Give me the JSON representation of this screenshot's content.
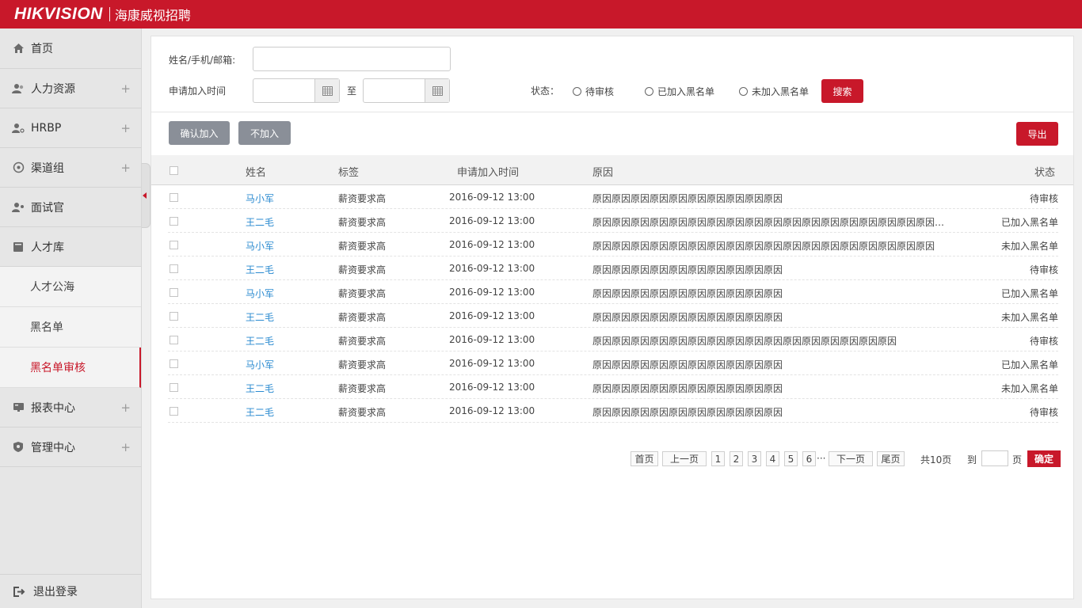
{
  "brand": {
    "logo": "HIKVISION",
    "subtitle": "海康威视招聘",
    "accent": "#c8182a"
  },
  "sidebar": {
    "items": [
      {
        "label": "首页",
        "icon": "home-icon",
        "expandable": false
      },
      {
        "label": "人力资源",
        "icon": "user-group-icon",
        "expandable": true
      },
      {
        "label": "HRBP",
        "icon": "user-key-icon",
        "expandable": true
      },
      {
        "label": "渠道组",
        "icon": "globe-icon",
        "expandable": true
      },
      {
        "label": "面试官",
        "icon": "user-gear-icon",
        "expandable": false
      },
      {
        "label": "人才库",
        "icon": "book-icon",
        "expandable": false
      }
    ],
    "subitems": [
      {
        "label": "人才公海"
      },
      {
        "label": "黑名单"
      },
      {
        "label": "黑名单审核",
        "active": true
      }
    ],
    "items2": [
      {
        "label": "报表中心",
        "icon": "report-icon",
        "expandable": true
      },
      {
        "label": "管理中心",
        "icon": "shield-icon",
        "expandable": true
      }
    ],
    "expand_symbol": "+",
    "logout": "退出登录"
  },
  "filter": {
    "name_label": "姓名/手机/邮箱:",
    "name_value": "",
    "date_label": "申请加入时间",
    "date_to": "至",
    "status_label": "状态：",
    "status_options": [
      "待审核",
      "已加入黑名单",
      "未加入黑名单"
    ],
    "search_button": "搜索"
  },
  "actions": {
    "confirm": "确认加入",
    "reject": "不加入",
    "export": "导出"
  },
  "table": {
    "headers": {
      "name": "姓名",
      "tag": "标签",
      "time": "申请加入时间",
      "reason": "原因",
      "status": "状态"
    },
    "rows": [
      {
        "name": "马小军",
        "tag": "薪资要求高",
        "time": "2016-09-12 13:00",
        "reason": "原因原因原因原因原因原因原因原因原因原因",
        "status": "待审核"
      },
      {
        "name": "王二毛",
        "tag": "薪资要求高",
        "time": "2016-09-12 13:00",
        "reason": "原因原因原因原因原因原因原因原因原因原因原因原因原因原因原因原因原因原因原因原因原因原因原因原因原因...",
        "status": "已加入黑名单"
      },
      {
        "name": "马小军",
        "tag": "薪资要求高",
        "time": "2016-09-12 13:00",
        "reason": "原因原因原因原因原因原因原因原因原因原因原因原因原因原因原因原因原因原因",
        "status": "未加入黑名单"
      },
      {
        "name": "王二毛",
        "tag": "薪资要求高",
        "time": "2016-09-12 13:00",
        "reason": "原因原因原因原因原因原因原因原因原因原因",
        "status": "待审核"
      },
      {
        "name": "马小军",
        "tag": "薪资要求高",
        "time": "2016-09-12 13:00",
        "reason": "原因原因原因原因原因原因原因原因原因原因",
        "status": "已加入黑名单"
      },
      {
        "name": "王二毛",
        "tag": "薪资要求高",
        "time": "2016-09-12 13:00",
        "reason": "原因原因原因原因原因原因原因原因原因原因",
        "status": "未加入黑名单"
      },
      {
        "name": "王二毛",
        "tag": "薪资要求高",
        "time": "2016-09-12 13:00",
        "reason": "原因原因原因原因原因原因原因原因原因原因原因原因原因原因原因原因",
        "status": "待审核"
      },
      {
        "name": "马小军",
        "tag": "薪资要求高",
        "time": "2016-09-12 13:00",
        "reason": "原因原因原因原因原因原因原因原因原因原因",
        "status": "已加入黑名单"
      },
      {
        "name": "王二毛",
        "tag": "薪资要求高",
        "time": "2016-09-12 13:00",
        "reason": "原因原因原因原因原因原因原因原因原因原因",
        "status": "未加入黑名单"
      },
      {
        "name": "王二毛",
        "tag": "薪资要求高",
        "time": "2016-09-12 13:00",
        "reason": "原因原因原因原因原因原因原因原因原因原因",
        "status": "待审核"
      }
    ]
  },
  "pagination": {
    "first": "首页",
    "prev": "上一页",
    "pages": [
      "1",
      "2",
      "3",
      "4",
      "5",
      "6"
    ],
    "ellipsis": "···",
    "next": "下一页",
    "last": "尾页",
    "total": "共10页",
    "goto": "到",
    "page_unit": "页",
    "page_value": "",
    "confirm": "确定"
  }
}
